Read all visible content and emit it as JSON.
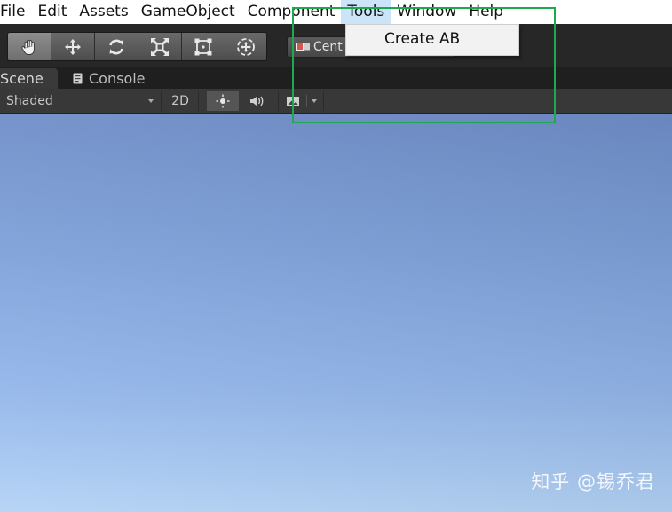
{
  "menubar": {
    "items": [
      {
        "label": "File"
      },
      {
        "label": "Edit"
      },
      {
        "label": "Assets"
      },
      {
        "label": "GameObject"
      },
      {
        "label": "Component"
      },
      {
        "label": "Tools"
      },
      {
        "label": "Window"
      },
      {
        "label": "Help"
      }
    ],
    "active": "Tools"
  },
  "toolbar": {
    "tools": [
      "hand-icon",
      "move-icon",
      "rotate-icon",
      "scale-icon",
      "rect-transform-icon",
      "transform-icon"
    ],
    "active_tool": "hand-icon",
    "pivot_label": "Cent"
  },
  "tools_menu": {
    "items": [
      {
        "label": "Create AB"
      }
    ]
  },
  "tabs": {
    "scene": "Scene",
    "console": "Console"
  },
  "scene_toolbar": {
    "shading_mode": "Shaded",
    "mode_2d": "2D"
  },
  "watermark": "知乎 @锡乔君",
  "colors": {
    "highlight": "#1ea84f",
    "menu_active": "#cce4f7",
    "toolbar_bg": "#272727"
  }
}
